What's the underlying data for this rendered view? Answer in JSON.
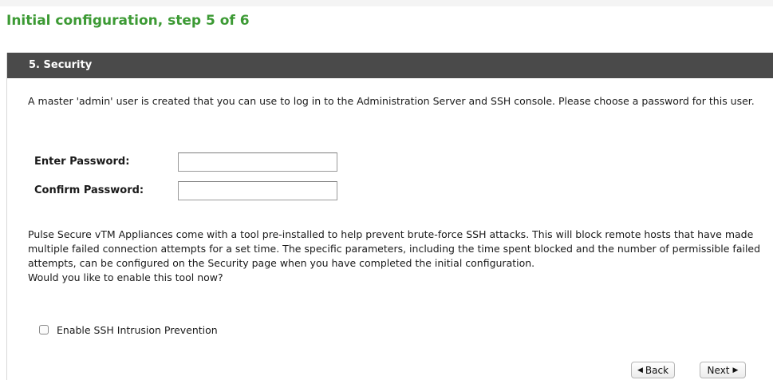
{
  "page_title": "Initial configuration, step 5 of 6",
  "section": {
    "header": "5. Security",
    "intro_text": "A master 'admin' user is created that you can use to log in to the Administration Server and SSH console. Please choose a password for this user."
  },
  "form": {
    "enter_password_label": "Enter Password:",
    "enter_password_value": "",
    "confirm_password_label": "Confirm Password:",
    "confirm_password_value": ""
  },
  "ssh": {
    "description": "Pulse Secure vTM Appliances come with a tool pre-installed to help prevent brute-force SSH attacks. This will block remote hosts that have made multiple failed connection attempts for a set time. The specific parameters, including the time spent blocked and the number of permissible failed attempts, can be configured on the Security page when you have completed the initial configuration.",
    "question": "Would you like to enable this tool now?",
    "checkbox_label": "Enable SSH Intrusion Prevention",
    "checkbox_checked": false
  },
  "buttons": {
    "back_label": "Back",
    "next_label": "Next"
  },
  "icons": {
    "back": "triangle-left-icon",
    "next": "triangle-right-icon"
  },
  "colors": {
    "title": "#3c9a34",
    "header_bg": "#4a4a4a"
  }
}
